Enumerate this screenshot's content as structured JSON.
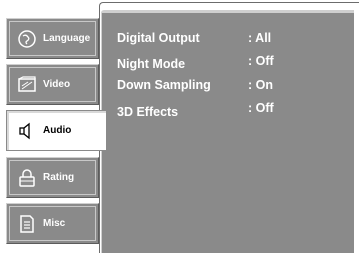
{
  "tabs": [
    {
      "label": "Language",
      "icon": "language-globe-icon",
      "active": false
    },
    {
      "label": "Video",
      "icon": "video-screen-icon",
      "active": false
    },
    {
      "label": "Audio",
      "icon": "speaker-icon",
      "active": true
    },
    {
      "label": "Rating",
      "icon": "lock-icon",
      "active": false
    },
    {
      "label": "Misc",
      "icon": "document-icon",
      "active": false
    }
  ],
  "settings": [
    {
      "label": "Digital Output",
      "value": ": All"
    },
    {
      "label": "Night  Mode",
      "value": ": Off"
    },
    {
      "label": "Down Sampling",
      "value": ": On"
    },
    {
      "label": "3D Effects",
      "value": ": Off"
    }
  ],
  "colors": {
    "panel": "#8a8a8a",
    "active_tab": "#ffffff",
    "text": "#ffffff"
  }
}
